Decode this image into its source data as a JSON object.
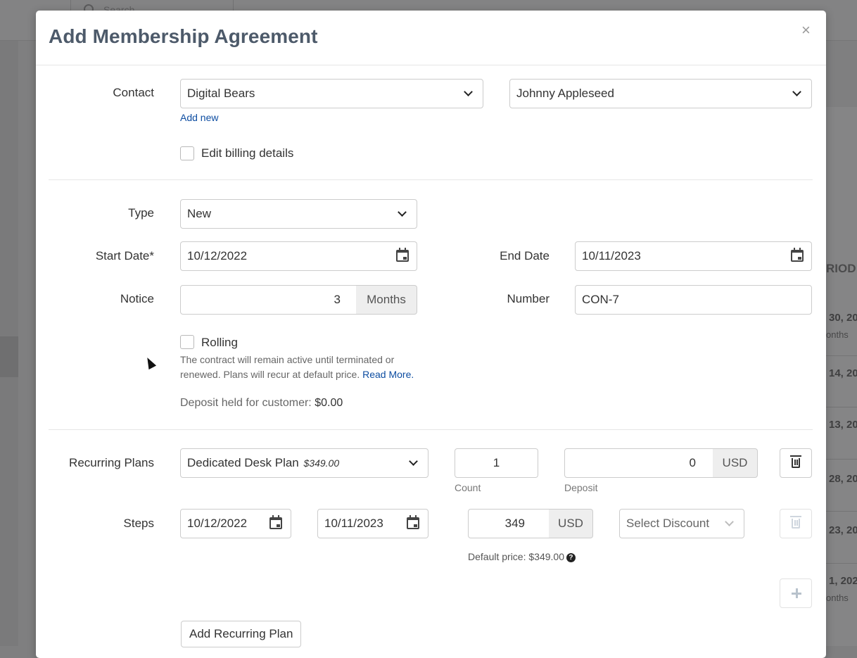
{
  "background": {
    "search_placeholder": "Search",
    "period_header": "RIOD",
    "rows": [
      {
        "date": "30, 20",
        "sub": "onths"
      },
      {
        "date": "14, 20",
        "sub": ""
      },
      {
        "date": "13, 20",
        "sub": ""
      },
      {
        "date": "28, 20",
        "sub": ""
      },
      {
        "date": "23, 20",
        "sub": ""
      },
      {
        "date": "1, 202",
        "sub": "onths"
      }
    ]
  },
  "modal": {
    "title": "Add Membership Agreement",
    "close_glyph": "×"
  },
  "contact": {
    "label": "Contact",
    "company": "Digital Bears",
    "person": "Johnny Appleseed",
    "add_new": "Add new",
    "edit_billing_label": "Edit billing details",
    "edit_billing_checked": false
  },
  "type": {
    "label": "Type",
    "value": "New"
  },
  "dates": {
    "start_label": "Start Date*",
    "start_value": "10/12/2022",
    "end_label": "End Date",
    "end_value": "10/11/2023"
  },
  "notice": {
    "label": "Notice",
    "value": "3",
    "unit": "Months"
  },
  "number": {
    "label": "Number",
    "value": "CON-7"
  },
  "rolling": {
    "label": "Rolling",
    "checked": false,
    "help_text": "The contract will remain active until terminated or renewed. Plans will recur at default price.",
    "read_more": "Read More."
  },
  "deposit_held": {
    "text": "Deposit held for customer:",
    "amount": "$0.00"
  },
  "recurring": {
    "label": "Recurring Plans",
    "plan_name": "Dedicated Desk Plan",
    "plan_price": "$349.00",
    "count_value": "1",
    "count_label": "Count",
    "deposit_value": "0",
    "deposit_currency": "USD",
    "deposit_label": "Deposit"
  },
  "steps": {
    "label": "Steps",
    "start": "10/12/2022",
    "end": "10/11/2023",
    "price": "349",
    "currency": "USD",
    "discount_placeholder": "Select Discount",
    "default_price_text": "Default price: $349.00",
    "help_glyph": "?"
  },
  "actions": {
    "add_recurring_plan": "Add Recurring Plan"
  }
}
